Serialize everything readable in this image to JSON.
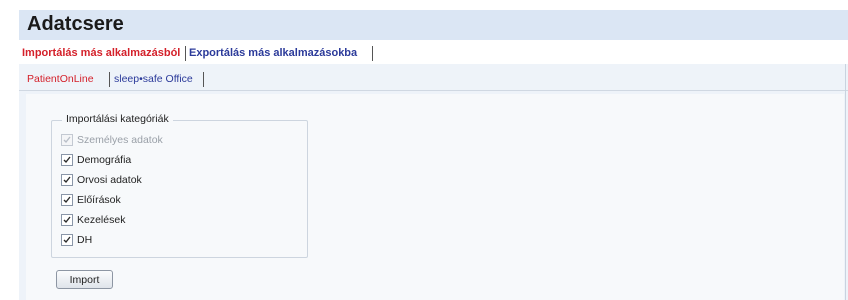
{
  "page": {
    "title": "Adatcsere"
  },
  "main_tabs": [
    {
      "label": "Importálás más alkalmazásból",
      "active": true
    },
    {
      "label": "Exportálás más alkalmazásokba",
      "active": false
    }
  ],
  "sub_tabs": [
    {
      "label": "PatientOnLine",
      "active": true
    },
    {
      "label": "sleep•safe Office",
      "active": false
    }
  ],
  "import_categories": {
    "legend": "Importálási kategóriák",
    "items": [
      {
        "label": "Személyes adatok",
        "checked": true,
        "disabled": true
      },
      {
        "label": "Demográfia",
        "checked": true,
        "disabled": false
      },
      {
        "label": "Orvosi adatok",
        "checked": true,
        "disabled": false
      },
      {
        "label": "Előírások",
        "checked": true,
        "disabled": false
      },
      {
        "label": "Kezelések",
        "checked": true,
        "disabled": false
      },
      {
        "label": "DH",
        "checked": true,
        "disabled": false
      }
    ]
  },
  "actions": {
    "import_label": "Import"
  },
  "colors": {
    "active_tab": "#d4202a",
    "inactive_tab": "#2b3a9a",
    "title_bar": "#dbe6f4",
    "content_bg": "#eef3f9"
  }
}
